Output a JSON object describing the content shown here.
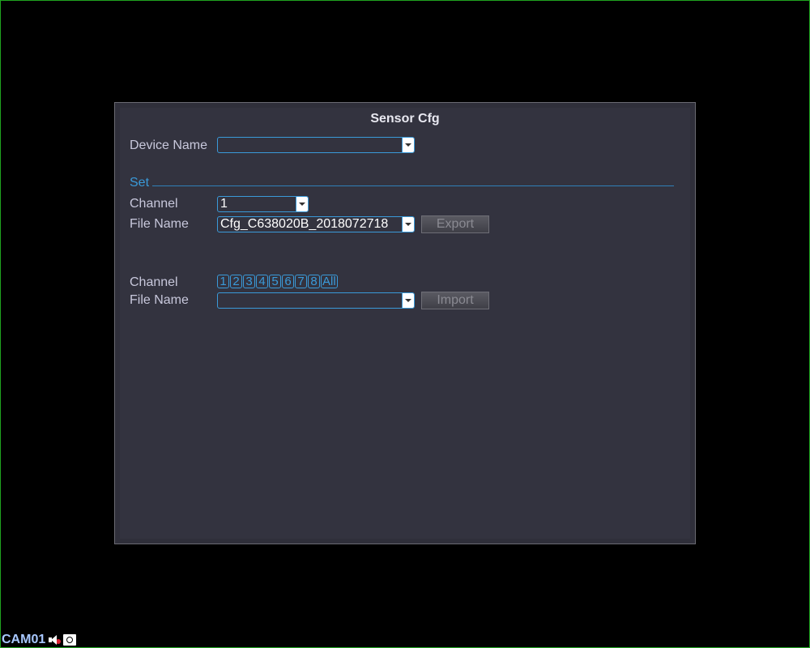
{
  "dialog": {
    "title": "Sensor Cfg",
    "device_name_label": "Device Name",
    "device_name_value": "",
    "set_section_label": "Set",
    "export": {
      "channel_label": "Channel",
      "channel_value": "1",
      "file_name_label": "File Name",
      "file_name_value": "Cfg_C638020B_2018072718",
      "button_label": "Export"
    },
    "import": {
      "channel_label": "Channel",
      "channels": [
        "1",
        "2",
        "3",
        "4",
        "5",
        "6",
        "7",
        "8",
        "All"
      ],
      "file_name_label": "File Name",
      "file_name_value": "",
      "button_label": "Import"
    }
  },
  "status_bar": {
    "camera_name": "CAM01",
    "icons": [
      "speaker-muted-icon",
      "camera-icon"
    ]
  },
  "colors": {
    "accent": "#3a9ad9",
    "dialog_bg": "#33333f",
    "screen_bg": "#000000"
  }
}
